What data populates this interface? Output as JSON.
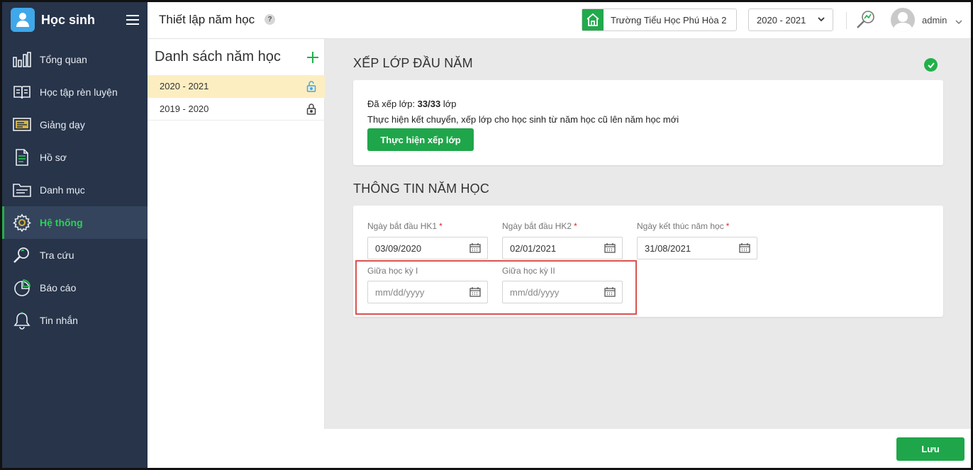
{
  "app": {
    "title": "Học sinh"
  },
  "sidebar": {
    "items": [
      {
        "label": "Tổng quan",
        "icon": "bar-chart-icon"
      },
      {
        "label": "Học tập rèn luyện",
        "icon": "book-icon"
      },
      {
        "label": "Giảng dạy",
        "icon": "teaching-board-icon"
      },
      {
        "label": "Hồ sơ",
        "icon": "document-icon"
      },
      {
        "label": "Danh mục",
        "icon": "folder-icon"
      },
      {
        "label": "Hệ thống",
        "icon": "gear-icon",
        "active": true
      },
      {
        "label": "Tra cứu",
        "icon": "search-icon"
      },
      {
        "label": "Báo cáo",
        "icon": "pie-chart-icon"
      },
      {
        "label": "Tin nhắn",
        "icon": "bell-icon"
      }
    ]
  },
  "header": {
    "title": "Thiết lập năm học",
    "help": "?",
    "school": "Trường Tiểu Học Phú Hòa 2",
    "year": "2020 - 2021",
    "user": "admin"
  },
  "year_list": {
    "title": "Danh sách năm học",
    "items": [
      {
        "label": "2020 - 2021",
        "selected": true,
        "lock": "unlocked"
      },
      {
        "label": "2019 - 2020",
        "selected": false,
        "lock": "locked"
      }
    ]
  },
  "class_setup": {
    "title": "XẾP LỚP ĐẦU NĂM",
    "status_prefix": "Đã xếp lớp: ",
    "status_count": "33/33",
    "status_suffix": " lớp",
    "description": "Thực hiện kết chuyển, xếp lớp cho học sinh từ năm học cũ lên năm học mới",
    "button": "Thực hiện xếp lớp"
  },
  "year_info": {
    "title": "THÔNG TIN NĂM HỌC",
    "fields": {
      "hk1_start": {
        "label": "Ngày bắt đầu HK1",
        "value": "03/09/2020"
      },
      "hk2_start": {
        "label": "Ngày bắt đầu HK2",
        "value": "02/01/2021"
      },
      "year_end": {
        "label": "Ngày kết thúc năm học",
        "value": "31/08/2021"
      },
      "mid_hk1": {
        "label": "Giữa học kỳ I",
        "placeholder": "mm/dd/yyyy"
      },
      "mid_hk2": {
        "label": "Giữa học kỳ II",
        "placeholder": "mm/dd/yyyy"
      }
    },
    "required_mark": "*"
  },
  "footer": {
    "save": "Lưu"
  },
  "colors": {
    "sidebar_bg": "#27344a",
    "accent_green": "#1fa64a",
    "selected_row": "#fdeec2",
    "highlight_red": "#d9534f"
  }
}
